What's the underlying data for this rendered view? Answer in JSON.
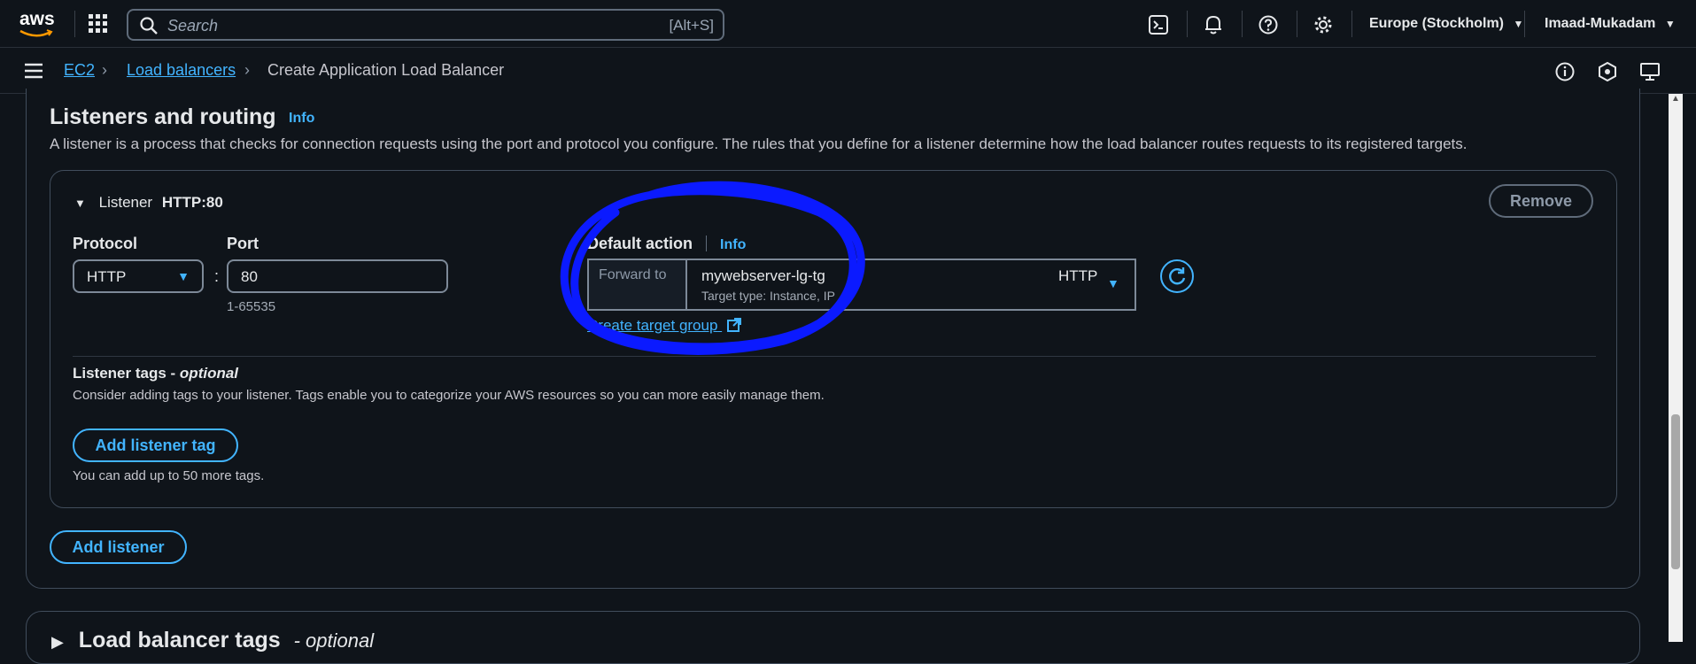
{
  "topnav": {
    "logo": "aws",
    "search_placeholder": "Search",
    "search_shortcut": "[Alt+S]",
    "region": "Europe (Stockholm)",
    "user": "Imaad-Mukadam",
    "icons": [
      "grid-icon",
      "cloudshell-icon",
      "bell-icon",
      "help-icon",
      "gear-icon"
    ]
  },
  "breadcrumb": {
    "items": [
      "EC2",
      "Load balancers"
    ],
    "current": "Create Application Load Balancer"
  },
  "listeners": {
    "title": "Listeners and routing",
    "info": "Info",
    "description": "A listener is a process that checks for connection requests using the port and protocol you configure. The rules that you define for a listener determine how the load balancer routes requests to its registered targets.",
    "listener": {
      "label": "Listener",
      "name": "HTTP:80",
      "remove": "Remove",
      "protocol_label": "Protocol",
      "protocol_value": "HTTP",
      "port_label": "Port",
      "port_value": "80",
      "port_hint": "1-65535",
      "colon": ":",
      "default_action_label": "Default action",
      "default_action_info": "Info",
      "forward_to": "Forward to",
      "target_group_name": "mywebserver-lg-tg",
      "target_group_type": "Target type: Instance, IP",
      "target_group_protocol": "HTTP",
      "create_target_group": "Create target group",
      "tags_title": "Listener tags - ",
      "tags_optional": "optional",
      "tags_description": "Consider adding tags to your listener. Tags enable you to categorize your AWS resources so you can more easily manage them.",
      "add_tag": "Add listener tag",
      "tags_limit": "You can add up to 50 more tags."
    },
    "add_listener": "Add listener"
  },
  "lb_tags": {
    "title": "Load balancer tags",
    "optional": "- optional"
  },
  "colors": {
    "accent": "#42b4ff",
    "background": "#0f141a",
    "annotation": "#0b1aff"
  }
}
